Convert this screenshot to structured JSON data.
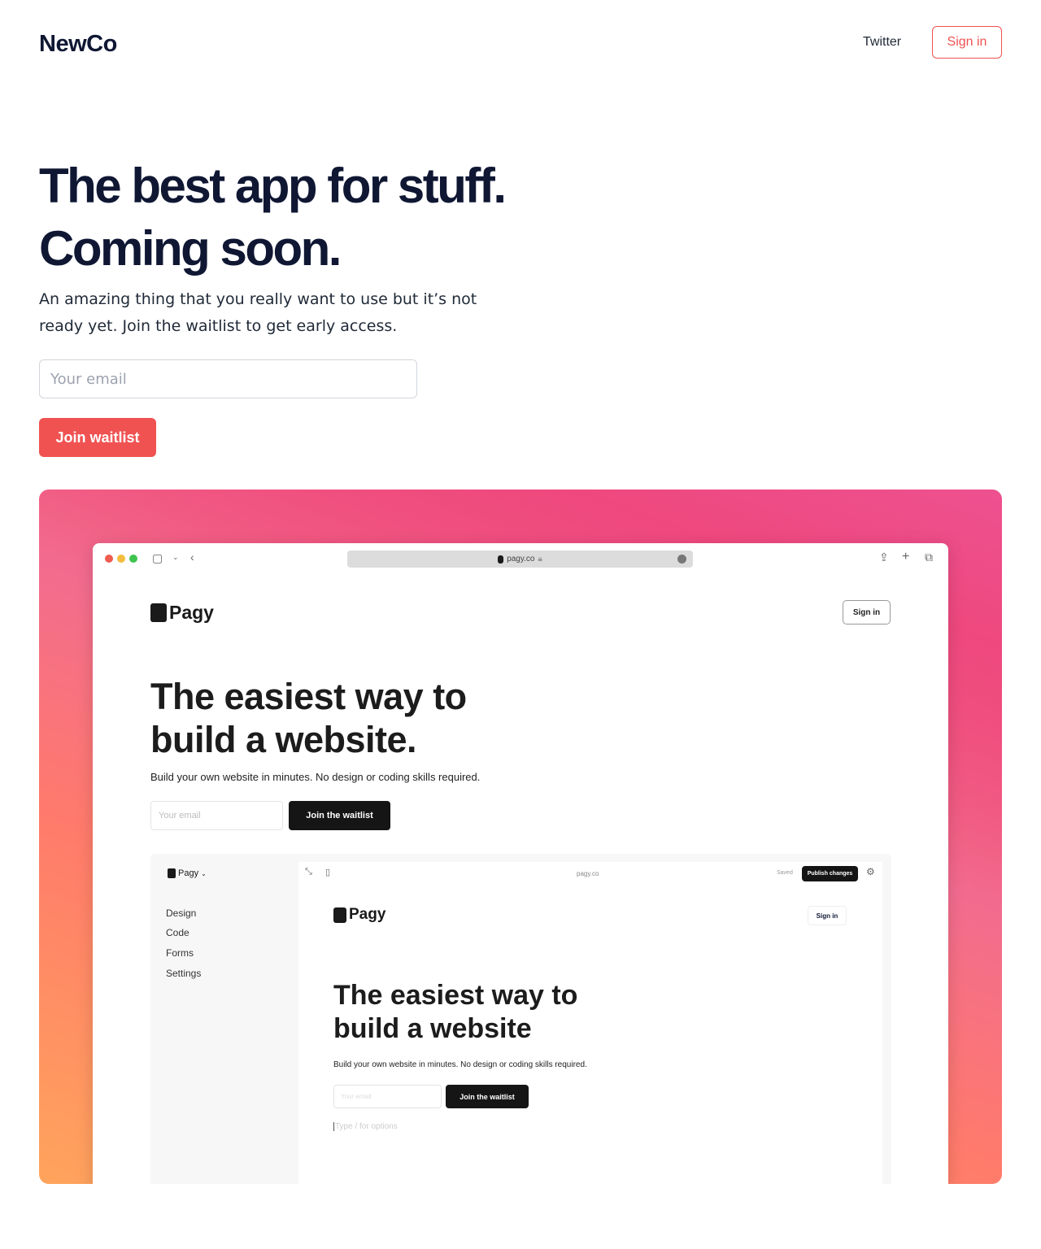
{
  "nav": {
    "logo": "NewCo",
    "twitter": "Twitter",
    "sign_in": "Sign in"
  },
  "hero": {
    "headline": "The best app for stuff. Coming soon.",
    "subtitle": "An amazing thing that you really want to use but it’s not ready yet. Join the waitlist to get early access.",
    "email_placeholder": "Your email",
    "join_label": "Join waitlist"
  },
  "colors": {
    "accent": "#f05252",
    "text": "#0f1733"
  },
  "screenshot": {
    "browser": {
      "url": "pagy.co"
    },
    "site": {
      "logo": "Pagy",
      "sign_in": "Sign in",
      "headline": "The easiest way to build a website.",
      "subtitle": "Build your own website in minutes. No design or coding skills required.",
      "email_placeholder": "Your email",
      "join_label": "Join the waitlist"
    },
    "editor": {
      "workspace": "Pagy",
      "menu": [
        "Design",
        "Code",
        "Forms",
        "Settings"
      ],
      "url": "pagy.co",
      "status": "Saved",
      "publish": "Publish changes",
      "preview": {
        "logo": "Pagy",
        "sign_in": "Sign in",
        "headline": "The easiest way to build a website",
        "subtitle": "Build your own website in minutes. No design or coding skills required.",
        "email_placeholder": "Your email",
        "join_label": "Join the waitlist",
        "block_placeholder": "Type / for options"
      }
    }
  }
}
